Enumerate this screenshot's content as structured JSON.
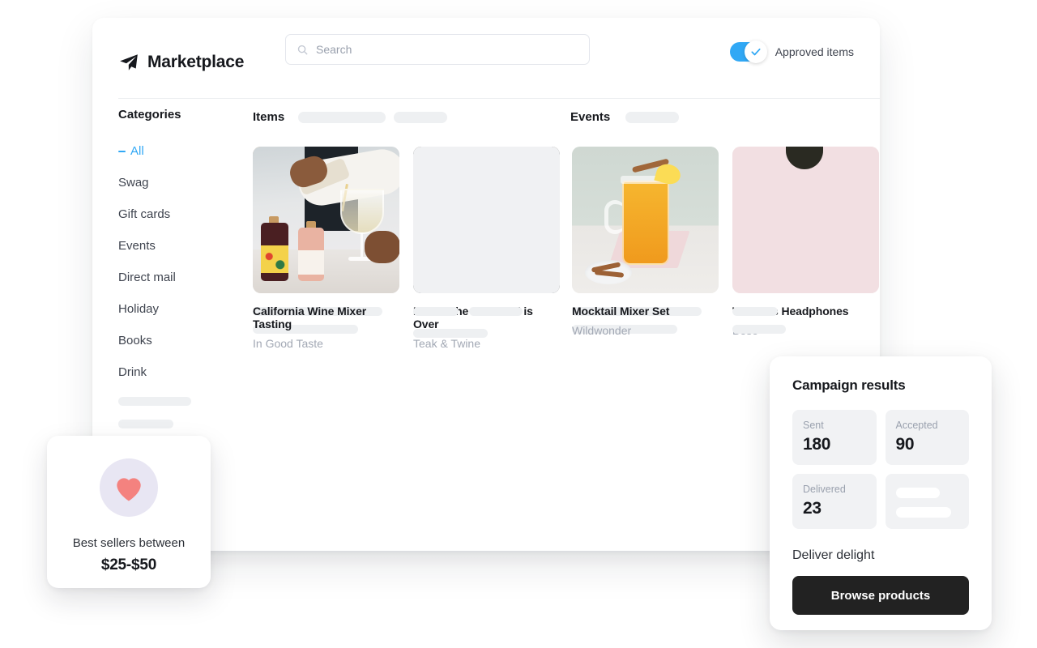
{
  "header": {
    "brand_icon": "paper-plane-icon",
    "title": "Marketplace",
    "search": {
      "placeholder": "Search",
      "value": "",
      "icon": "search-icon"
    },
    "toggle": {
      "label": "Approved items",
      "state": "on",
      "icon": "check-icon",
      "color": "#31a8f5"
    }
  },
  "sidebar": {
    "title": "Categories",
    "items": [
      {
        "label": "All",
        "active": true
      },
      {
        "label": "Swag",
        "active": false
      },
      {
        "label": "Gift cards",
        "active": false
      },
      {
        "label": "Events",
        "active": false
      },
      {
        "label": "Direct mail",
        "active": false
      },
      {
        "label": "Holiday",
        "active": false
      },
      {
        "label": "Books",
        "active": false
      },
      {
        "label": "Drink",
        "active": false
      }
    ],
    "placeholder_widths": [
      90,
      68,
      78
    ]
  },
  "sections": {
    "items_label": "Items",
    "items_placeholder_widths": [
      108,
      66
    ],
    "events_label": "Events",
    "events_placeholder_widths": [
      66
    ]
  },
  "cards": [
    {
      "title": "",
      "subtitle": "",
      "image": "brigadeiro-truffles-photo",
      "skeleton": true
    },
    {
      "title": "Before the Weekend is Over",
      "subtitle": "Teak & Twine",
      "image": "gift-box-photo",
      "skeleton": false
    },
    {
      "title": "",
      "subtitle": "",
      "image": "placeholder",
      "skeleton": true
    },
    {
      "title": "Wireless Headphones",
      "subtitle": "Bose",
      "image": "bose-headphones-photo",
      "skeleton": false
    },
    {
      "title": "California Wine Mixer Tasting",
      "subtitle": "In Good Taste",
      "image": "wine-tasting-photo",
      "skeleton": false
    },
    {
      "title": "",
      "subtitle": "",
      "image": "placeholder",
      "skeleton": true
    },
    {
      "title": "Mocktail Mixer Set",
      "subtitle": "Wildwonder",
      "image": "mocktail-photo",
      "skeleton": false
    },
    {
      "title": "",
      "subtitle": "",
      "image": "pink-placeholder",
      "skeleton": true
    }
  ],
  "bestsellers": {
    "icon": "heart-icon",
    "icon_color": "#f4827f",
    "line1": "Best sellers between",
    "line2": "$25-$50"
  },
  "campaign": {
    "title": "Campaign results",
    "stats": [
      {
        "label": "Sent",
        "value": "180"
      },
      {
        "label": "Accepted",
        "value": "90"
      },
      {
        "label": "Delivered",
        "value": "23"
      },
      {
        "label": "",
        "value": ""
      }
    ],
    "subheading": "Deliver delight",
    "button_label": "Browse products"
  }
}
